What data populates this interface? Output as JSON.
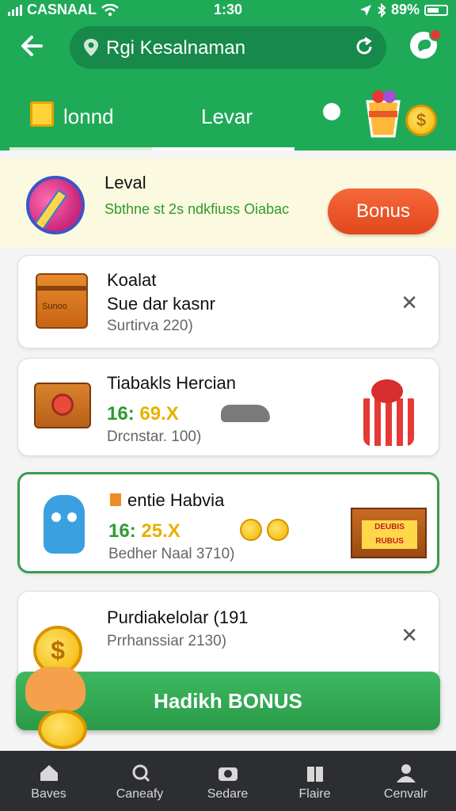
{
  "statusbar": {
    "carrier": "CASNAAL",
    "time": "1:30",
    "battery": "89%"
  },
  "header": {
    "search_text": "Rgi Kesalnaman"
  },
  "tabs": [
    {
      "label": "lonnd"
    },
    {
      "label": "Levar"
    }
  ],
  "level": {
    "title": "Leval",
    "description": "Sbthne st 2s ndkfiuss Oiabac",
    "button_label": "Bonus"
  },
  "cards": [
    {
      "title": "Koalat",
      "subtitle": "Sue dar kasnr",
      "meta": "Surtirva 220)",
      "close": "✕",
      "icon_text": "Sunoo"
    },
    {
      "title": "Tiabakls Hercian",
      "reward_a": "16:",
      "reward_b": "69.X",
      "meta": "Drcnstar. 100)"
    },
    {
      "title": "entie Habvia",
      "reward_a": "16:",
      "reward_b": "25.X",
      "meta": "Bedher Naal 3710)",
      "crate_label": "DEUBIS RUBUS"
    },
    {
      "title": "Purdiakelolar (191",
      "meta": "Prrhanssiar 2130)",
      "close": "✕"
    }
  ],
  "claim_button": "Hadikh BONUS",
  "coin_symbol": "$",
  "bottom_nav": [
    {
      "label": "Baves",
      "icon": "home-icon"
    },
    {
      "label": "Caneafy",
      "icon": "search-icon"
    },
    {
      "label": "Sedare",
      "icon": "camera-icon"
    },
    {
      "label": "Flaire",
      "icon": "store-icon"
    },
    {
      "label": "Cenvalr",
      "icon": "profile-icon"
    }
  ],
  "colors": {
    "primary_green": "#1faa58",
    "bonus_orange": "#e8502a",
    "coin_gold": "#f2b400"
  }
}
